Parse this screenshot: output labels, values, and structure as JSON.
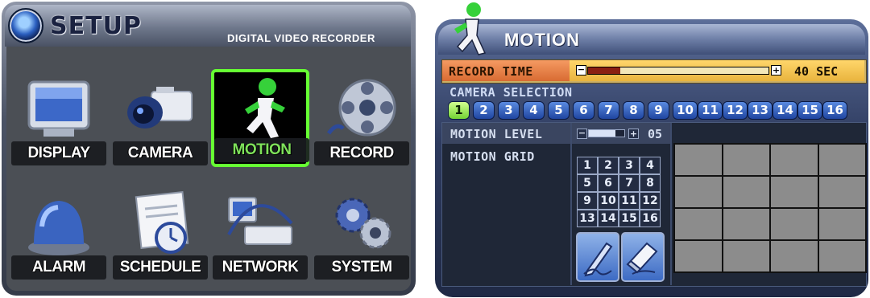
{
  "setup": {
    "title": "SETUP",
    "subtitle": "DIGITAL VIDEO RECORDER",
    "menu_items": [
      {
        "label": "DISPLAY",
        "icon": "monitor-icon",
        "selected": false
      },
      {
        "label": "CAMERA",
        "icon": "camera-icon",
        "selected": false
      },
      {
        "label": "MOTION",
        "icon": "running-person-icon",
        "selected": true
      },
      {
        "label": "RECORD",
        "icon": "film-reel-icon",
        "selected": false
      },
      {
        "label": "ALARM",
        "icon": "alarm-light-icon",
        "selected": false
      },
      {
        "label": "SCHEDULE",
        "icon": "calendar-clock-icon",
        "selected": false
      },
      {
        "label": "NETWORK",
        "icon": "network-dvr-icon",
        "selected": false
      },
      {
        "label": "SYSTEM",
        "icon": "gears-icon",
        "selected": false
      }
    ]
  },
  "motion": {
    "title": "MOTION",
    "record_time": {
      "label": "RECORD TIME",
      "minus": "−",
      "plus": "+",
      "value_text": "40 SEC",
      "level_fraction": 0.18
    },
    "camera_selection": {
      "label": "CAMERA SELECTION",
      "cameras": [
        "1",
        "2",
        "3",
        "4",
        "5",
        "6",
        "7",
        "8",
        "9",
        "10",
        "11",
        "12",
        "13",
        "14",
        "15",
        "16"
      ],
      "active_camera": "1"
    },
    "motion_level": {
      "label": "MOTION LEVEL",
      "minus": "−",
      "plus": "+",
      "value": "05",
      "level_fraction": 0.75
    },
    "motion_grid": {
      "label": "MOTION GRID",
      "numbers": [
        "1",
        "2",
        "3",
        "4",
        "5",
        "6",
        "7",
        "8",
        "9",
        "10",
        "11",
        "12",
        "13",
        "14",
        "15",
        "16"
      ],
      "tools": [
        "pen-icon",
        "eraser-icon"
      ]
    }
  },
  "colors": {
    "accent_green": "#66ff33",
    "record_time_bg": "#e9b43e",
    "camera_button": "#1f45a0",
    "grid_cell": "#8c8c8c"
  }
}
